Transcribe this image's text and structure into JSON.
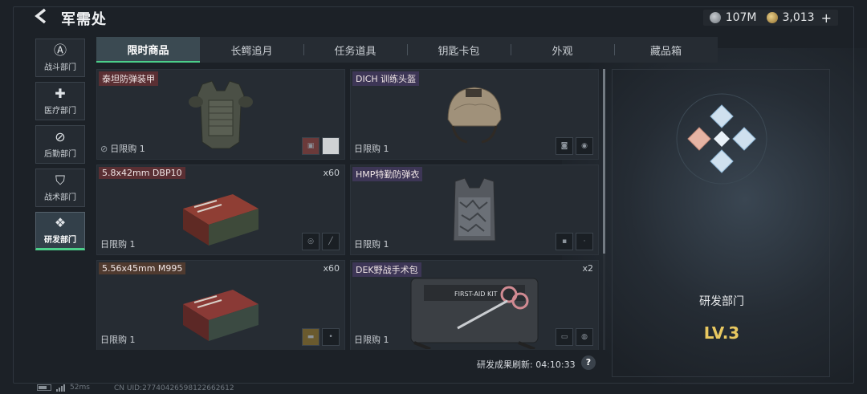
{
  "header": {
    "title": "军需处",
    "currency_silver": "107M",
    "currency_gold": "3,013",
    "plus": "+"
  },
  "sidebar": {
    "items": [
      {
        "label": "战斗部门",
        "icon": "Ⓐ"
      },
      {
        "label": "医疗部门",
        "icon": "✚"
      },
      {
        "label": "后勤部门",
        "icon": "⊘"
      },
      {
        "label": "战术部门",
        "icon": "⛉"
      },
      {
        "label": "研发部门",
        "icon": "❖"
      }
    ]
  },
  "tabs": [
    "限时商品",
    "长鳄追月",
    "任务道具",
    "钥匙卡包",
    "外观",
    "藏品箱"
  ],
  "products": [
    {
      "name": "泰坦防弹装甲",
      "qty": "",
      "limit": "日限购 1",
      "tag": "red"
    },
    {
      "name": "DICH 训练头盔",
      "qty": "",
      "limit": "日限购 1",
      "tag": "purple"
    },
    {
      "name": "5.8x42mm DBP10",
      "qty": "x60",
      "limit": "日限购 1",
      "tag": "red"
    },
    {
      "name": "HMP特勤防弹衣",
      "qty": "",
      "limit": "日限购 1",
      "tag": "purple"
    },
    {
      "name": "5.56x45mm M995",
      "qty": "x60",
      "limit": "日限购 1",
      "tag": "brown"
    },
    {
      "name": "DEK野战手术包",
      "qty": "x2",
      "limit": "日限购 1",
      "tag": "purple"
    }
  ],
  "kit_label": "FIRST-AID KIT",
  "right_panel": {
    "dept_name": "研发部门",
    "level": "LV.3"
  },
  "footer": {
    "refresh": "研发成果刷新: 04:10:33",
    "help": "?",
    "ping": "52ms",
    "uid": "CN UID:27740426598122662612"
  },
  "colors": {
    "accent_green": "#4ccf8a",
    "level_gold": "#e8c860",
    "tag_red": "#5a2f33",
    "tag_purple": "#3d3656"
  }
}
